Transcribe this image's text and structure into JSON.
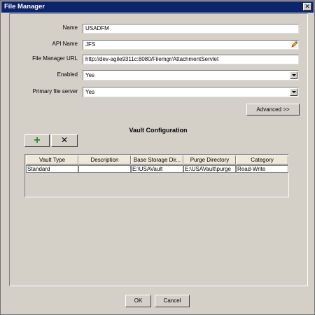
{
  "window": {
    "title": "File Manager",
    "close_glyph": "✕"
  },
  "form": {
    "name_label": "Name",
    "name_value": "USADFM",
    "api_label": "API Name",
    "api_value": "JFS",
    "url_label": "File Manager URL",
    "url_value": "http://dev-agile9311c:8080/Filemgr/AttachmentServlet",
    "enabled_label": "Enabled",
    "enabled_value": "Yes",
    "primary_label": "Primary file server",
    "primary_value": "Yes",
    "advanced_label": "Advanced >>"
  },
  "vault": {
    "title": "Vault Configuration",
    "add_glyph": "+",
    "remove_glyph": "✕",
    "columns": [
      "Vault Type",
      "Description",
      "Base Storage Dir...",
      "Purge Directory",
      "Category"
    ],
    "rows": [
      [
        "Standard",
        "",
        "E:\\USAVault",
        "E:\\USAVault\\purge",
        "Read-Write"
      ]
    ]
  },
  "footer": {
    "ok_label": "OK",
    "cancel_label": "Cancel"
  },
  "icons": {
    "api_field_icon": "pencil-icon"
  },
  "colors": {
    "title_bar": "#0b246a",
    "dialog_bg": "#d4d0c8",
    "add_icon": "#2a8a2a"
  }
}
